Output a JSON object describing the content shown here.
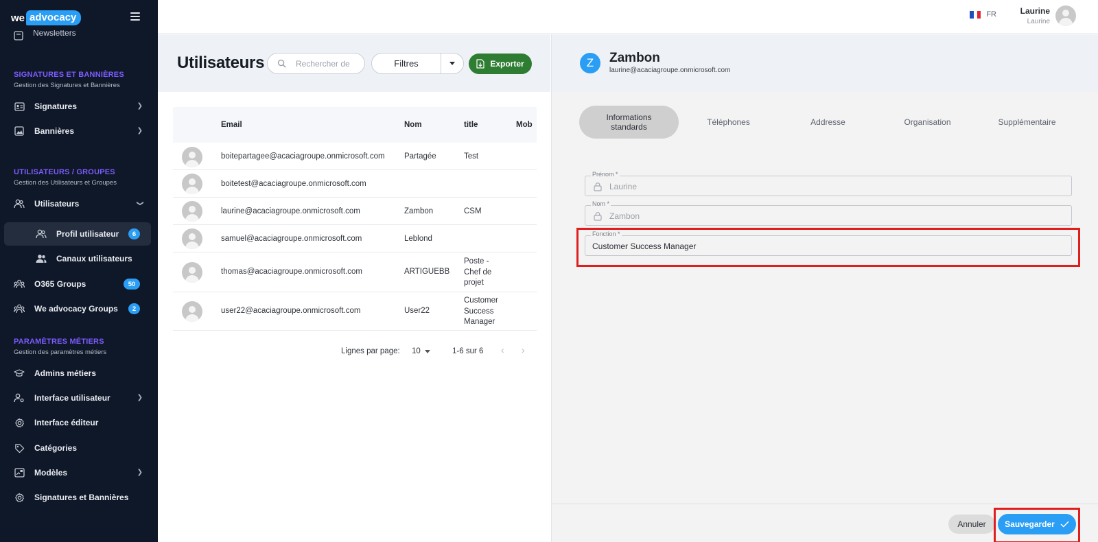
{
  "logo": {
    "we": "we",
    "advocacy": "advocacy"
  },
  "sidebar": {
    "partial_item": "Newsletters",
    "sections": [
      {
        "title": "SIGNATURES ET BANNIÈRES",
        "subtitle": "Gestion des Signatures et Bannières"
      },
      {
        "title": "UTILISATEURS / GROUPES",
        "subtitle": "Gestion des Utilisateurs et Groupes"
      },
      {
        "title": "PARAMÈTRES MÉTIERS",
        "subtitle": "Gestion des paramètres métiers"
      }
    ],
    "items": {
      "signatures": "Signatures",
      "bannieres": "Bannières",
      "utilisateurs": "Utilisateurs",
      "profil": "Profil utilisateur",
      "profil_badge": "6",
      "canaux": "Canaux utilisateurs",
      "o365": "O365 Groups",
      "o365_badge": "50",
      "weadv": "We advocacy Groups",
      "weadv_badge": "2",
      "admins": "Admins métiers",
      "interface_user": "Interface utilisateur",
      "interface_editor": "Interface éditeur",
      "categories": "Catégories",
      "modeles": "Modèles",
      "sig_ban": "Signatures et Bannières"
    }
  },
  "topbar": {
    "lang": "FR",
    "user_name": "Laurine",
    "user_sub": "Laurine"
  },
  "users": {
    "title": "Utilisateurs",
    "search_placeholder": "Rechercher de",
    "filters_label": "Filtres",
    "export_label": "Exporter",
    "columns": [
      "Email",
      "Nom",
      "title",
      "Mob"
    ],
    "rows": [
      {
        "email": "boitepartagee@acaciagroupe.onmicrosoft.com",
        "nom": "Partagée",
        "title": "Test"
      },
      {
        "email": "boitetest@acaciagroupe.onmicrosoft.com",
        "nom": "",
        "title": ""
      },
      {
        "email": "laurine@acaciagroupe.onmicrosoft.com",
        "nom": "Zambon",
        "title": "CSM"
      },
      {
        "email": "samuel@acaciagroupe.onmicrosoft.com",
        "nom": "Leblond",
        "title": ""
      },
      {
        "email": "thomas@acaciagroupe.onmicrosoft.com",
        "nom": "ARTIGUEBB",
        "title": "Poste - Chef de projet"
      },
      {
        "email": "user22@acaciagroupe.onmicrosoft.com",
        "nom": "User22",
        "title": "Customer Success Manager"
      }
    ],
    "pagination": {
      "label": "Lignes par page:",
      "per_page": "10",
      "range": "1-6 sur 6"
    }
  },
  "detail": {
    "initial": "Z",
    "name": "Zambon",
    "email": "laurine@acaciagroupe.onmicrosoft.com",
    "tabs": [
      "Informations standards",
      "Téléphones",
      "Addresse",
      "Organisation",
      "Supplémentaire"
    ],
    "fields": {
      "prenom_label": "Prénom *",
      "prenom_value": "Laurine",
      "nom_label": "Nom *",
      "nom_value": "Zambon",
      "fonction_label": "Fonction *",
      "fonction_value": "Customer Success Manager"
    },
    "cancel_label": "Annuler",
    "save_label": "Sauvegarder"
  },
  "colors": {
    "accent": "#2a9df4",
    "section_title": "#7c5cff",
    "sidebar_bg": "#0f1828",
    "export_green": "#2e7d32",
    "highlight_red": "#e01e1e"
  },
  "flag_colors": [
    "#1f4fbf",
    "#ffffff",
    "#e2262d"
  ]
}
